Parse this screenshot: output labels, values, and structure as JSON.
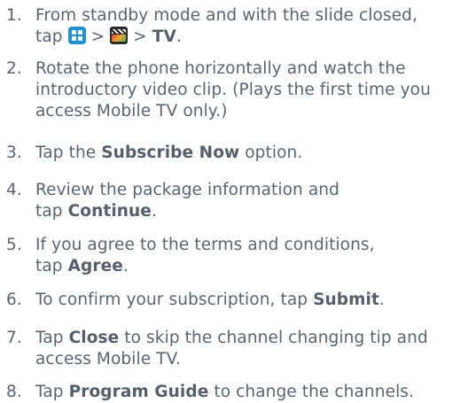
{
  "steps": [
    {
      "num": "1.",
      "lines": [
        {
          "a": "From standby mode and with the slide closed,"
        },
        {
          "a": "tap ",
          "sep1": " > ",
          "sep2": " > ",
          "bold": "TV",
          "end": "."
        }
      ],
      "icons": [
        "apps-grid-icon",
        "clapperboard-icon"
      ]
    },
    {
      "num": "2.",
      "lines": [
        {
          "a": "Rotate the phone horizontally and watch the"
        },
        {
          "a": "introductory video clip. (Plays the first time you"
        },
        {
          "a": "access Mobile TV only.)"
        }
      ]
    },
    {
      "num": "3.",
      "lines": [
        {
          "a": "Tap the ",
          "bold": "Subscribe Now",
          "end": " option."
        }
      ]
    },
    {
      "num": "4.",
      "lines": [
        {
          "a": "Review the package information and"
        },
        {
          "a": "tap ",
          "bold": "Continue",
          "end": "."
        }
      ]
    },
    {
      "num": "5.",
      "lines": [
        {
          "a": "If you agree to the terms and conditions,"
        },
        {
          "a": "tap ",
          "bold": "Agree",
          "end": "."
        }
      ]
    },
    {
      "num": "6.",
      "lines": [
        {
          "a": "To confirm your subscription, tap ",
          "bold": "Submit",
          "end": "."
        }
      ]
    },
    {
      "num": "7.",
      "lines": [
        {
          "a": "Tap ",
          "bold": "Close",
          "end": " to skip the channel changing tip and"
        },
        {
          "a": "access Mobile TV."
        }
      ]
    },
    {
      "num": "8.",
      "lines": [
        {
          "a": "Tap ",
          "bold": "Program Guide",
          "end": " to change the channels."
        }
      ]
    }
  ],
  "colors": {
    "text": "#5a6470",
    "apps_icon": "#1e90d6"
  }
}
